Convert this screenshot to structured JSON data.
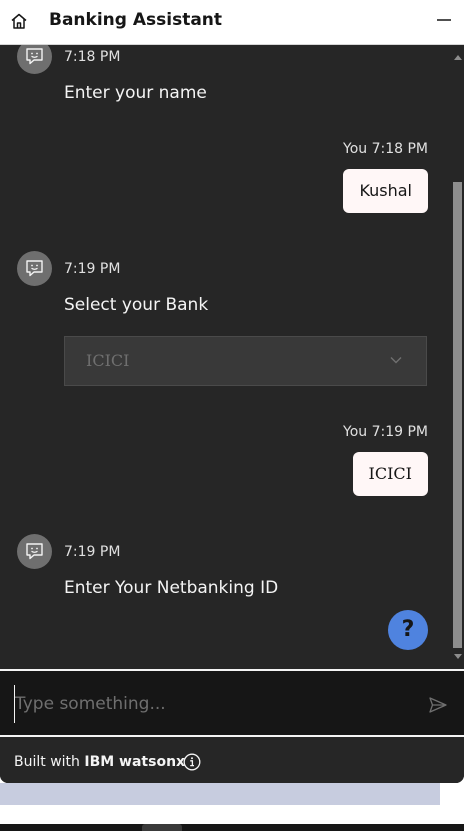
{
  "header": {
    "title": "Banking Assistant",
    "home_icon": "home-icon",
    "minimize_icon": "minimize-icon"
  },
  "messages": [
    {
      "sender": "bot",
      "time": "7:18 PM",
      "text": "Enter your name"
    },
    {
      "sender": "user",
      "meta": "You 7:18 PM",
      "text": "Kushal"
    },
    {
      "sender": "bot",
      "time": "7:19 PM",
      "text": "Select your Bank",
      "dropdown_value": "ICICI"
    },
    {
      "sender": "user",
      "meta": "You 7:19 PM",
      "text": "ICICI"
    },
    {
      "sender": "bot",
      "time": "7:19 PM",
      "text": "Enter Your Netbanking ID"
    }
  ],
  "help_button": {
    "label": "?"
  },
  "input": {
    "placeholder": "Type something...",
    "value": ""
  },
  "footer": {
    "prefix": "Built with",
    "brand": "IBM watsonx"
  },
  "colors": {
    "accent": "#4f83df",
    "panel": "#262626",
    "bubble": "#fff7f7"
  }
}
